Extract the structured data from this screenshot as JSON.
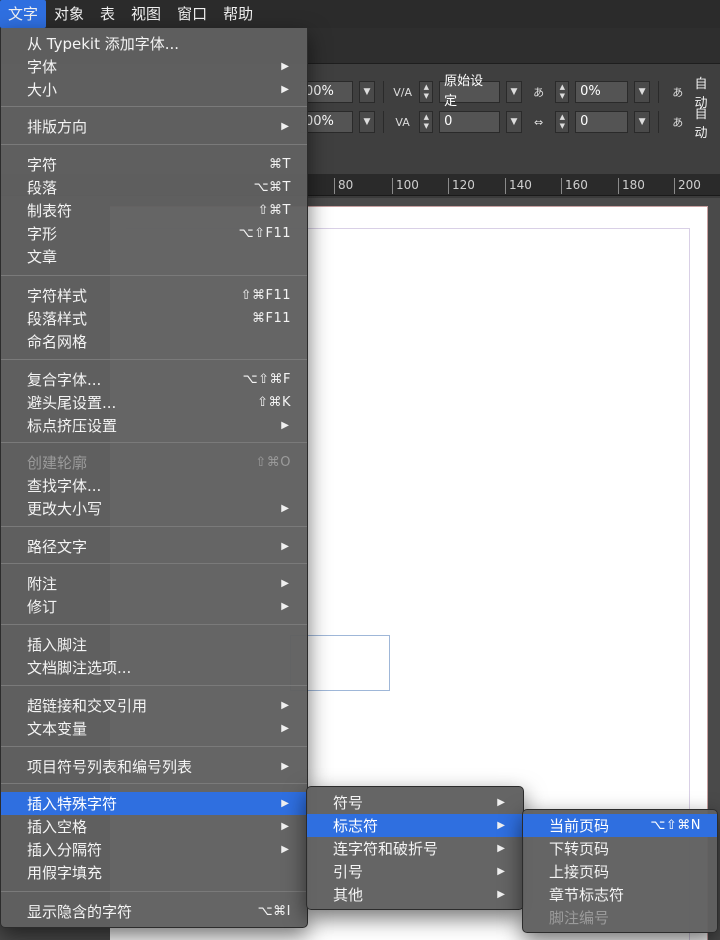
{
  "menubar": {
    "items": [
      "文字",
      "对象",
      "表",
      "视图",
      "窗口",
      "帮助"
    ],
    "active_index": 0
  },
  "control_panel": {
    "row1": {
      "scale_h": "00%",
      "tracking_method": "原始设定",
      "aki": "0%",
      "label_right": "自动"
    },
    "row2": {
      "scale_v": "00%",
      "kerning": "0",
      "grid_count": "0",
      "label_right": "自动"
    }
  },
  "ruler": {
    "ticks": [
      "80",
      "100",
      "120",
      "140",
      "160",
      "180",
      "200"
    ]
  },
  "type_menu": {
    "items": [
      {
        "label": "从 Typekit 添加字体...",
        "shortcut": "",
        "submenu": false,
        "disabled": false
      },
      {
        "label": "字体",
        "shortcut": "",
        "submenu": true,
        "disabled": false
      },
      {
        "label": "大小",
        "shortcut": "",
        "submenu": true,
        "disabled": false
      },
      {
        "label": "排版方向",
        "shortcut": "",
        "submenu": true,
        "disabled": false
      },
      {
        "label": "字符",
        "shortcut": "⌘T",
        "submenu": false,
        "disabled": false
      },
      {
        "label": "段落",
        "shortcut": "⌥⌘T",
        "submenu": false,
        "disabled": false
      },
      {
        "label": "制表符",
        "shortcut": "⇧⌘T",
        "submenu": false,
        "disabled": false
      },
      {
        "label": "字形",
        "shortcut": "⌥⇧F11",
        "submenu": false,
        "disabled": false
      },
      {
        "label": "文章",
        "shortcut": "",
        "submenu": false,
        "disabled": false
      },
      {
        "label": "字符样式",
        "shortcut": "⇧⌘F11",
        "submenu": false,
        "disabled": false
      },
      {
        "label": "段落样式",
        "shortcut": "⌘F11",
        "submenu": false,
        "disabled": false
      },
      {
        "label": "命名网格",
        "shortcut": "",
        "submenu": false,
        "disabled": false
      },
      {
        "label": "复合字体...",
        "shortcut": "⌥⇧⌘F",
        "submenu": false,
        "disabled": false
      },
      {
        "label": "避头尾设置...",
        "shortcut": "⇧⌘K",
        "submenu": false,
        "disabled": false
      },
      {
        "label": "标点挤压设置",
        "shortcut": "",
        "submenu": true,
        "disabled": false
      },
      {
        "label": "创建轮廓",
        "shortcut": "⇧⌘O",
        "submenu": false,
        "disabled": true
      },
      {
        "label": "查找字体...",
        "shortcut": "",
        "submenu": false,
        "disabled": false
      },
      {
        "label": "更改大小写",
        "shortcut": "",
        "submenu": true,
        "disabled": false
      },
      {
        "label": "路径文字",
        "shortcut": "",
        "submenu": true,
        "disabled": false
      },
      {
        "label": "附注",
        "shortcut": "",
        "submenu": true,
        "disabled": false
      },
      {
        "label": "修订",
        "shortcut": "",
        "submenu": true,
        "disabled": false
      },
      {
        "label": "插入脚注",
        "shortcut": "",
        "submenu": false,
        "disabled": false
      },
      {
        "label": "文档脚注选项...",
        "shortcut": "",
        "submenu": false,
        "disabled": false
      },
      {
        "label": "超链接和交叉引用",
        "shortcut": "",
        "submenu": true,
        "disabled": false
      },
      {
        "label": "文本变量",
        "shortcut": "",
        "submenu": true,
        "disabled": false
      },
      {
        "label": "项目符号列表和编号列表",
        "shortcut": "",
        "submenu": true,
        "disabled": false
      },
      {
        "label": "插入特殊字符",
        "shortcut": "",
        "submenu": true,
        "disabled": false,
        "highlighted": true
      },
      {
        "label": "插入空格",
        "shortcut": "",
        "submenu": true,
        "disabled": false
      },
      {
        "label": "插入分隔符",
        "shortcut": "",
        "submenu": true,
        "disabled": false
      },
      {
        "label": "用假字填充",
        "shortcut": "",
        "submenu": false,
        "disabled": false
      },
      {
        "label": "显示隐含的字符",
        "shortcut": "⌥⌘I",
        "submenu": false,
        "disabled": false
      }
    ]
  },
  "special_chars_menu": {
    "items": [
      {
        "label": "符号",
        "submenu": true
      },
      {
        "label": "标志符",
        "submenu": true,
        "highlighted": true
      },
      {
        "label": "连字符和破折号",
        "submenu": true
      },
      {
        "label": "引号",
        "submenu": true
      },
      {
        "label": "其他",
        "submenu": true
      }
    ]
  },
  "markers_menu": {
    "items": [
      {
        "label": "当前页码",
        "shortcut": "⌥⇧⌘N",
        "highlighted": true,
        "disabled": false
      },
      {
        "label": "下转页码",
        "shortcut": "",
        "disabled": false
      },
      {
        "label": "上接页码",
        "shortcut": "",
        "disabled": false
      },
      {
        "label": "章节标志符",
        "shortcut": "",
        "disabled": false
      },
      {
        "label": "脚注编号",
        "shortcut": "",
        "disabled": true
      }
    ]
  },
  "colors": {
    "highlight": "#2f6fe0",
    "menu_bg": "#606060",
    "menubar_bg": "#2b2b2b"
  }
}
